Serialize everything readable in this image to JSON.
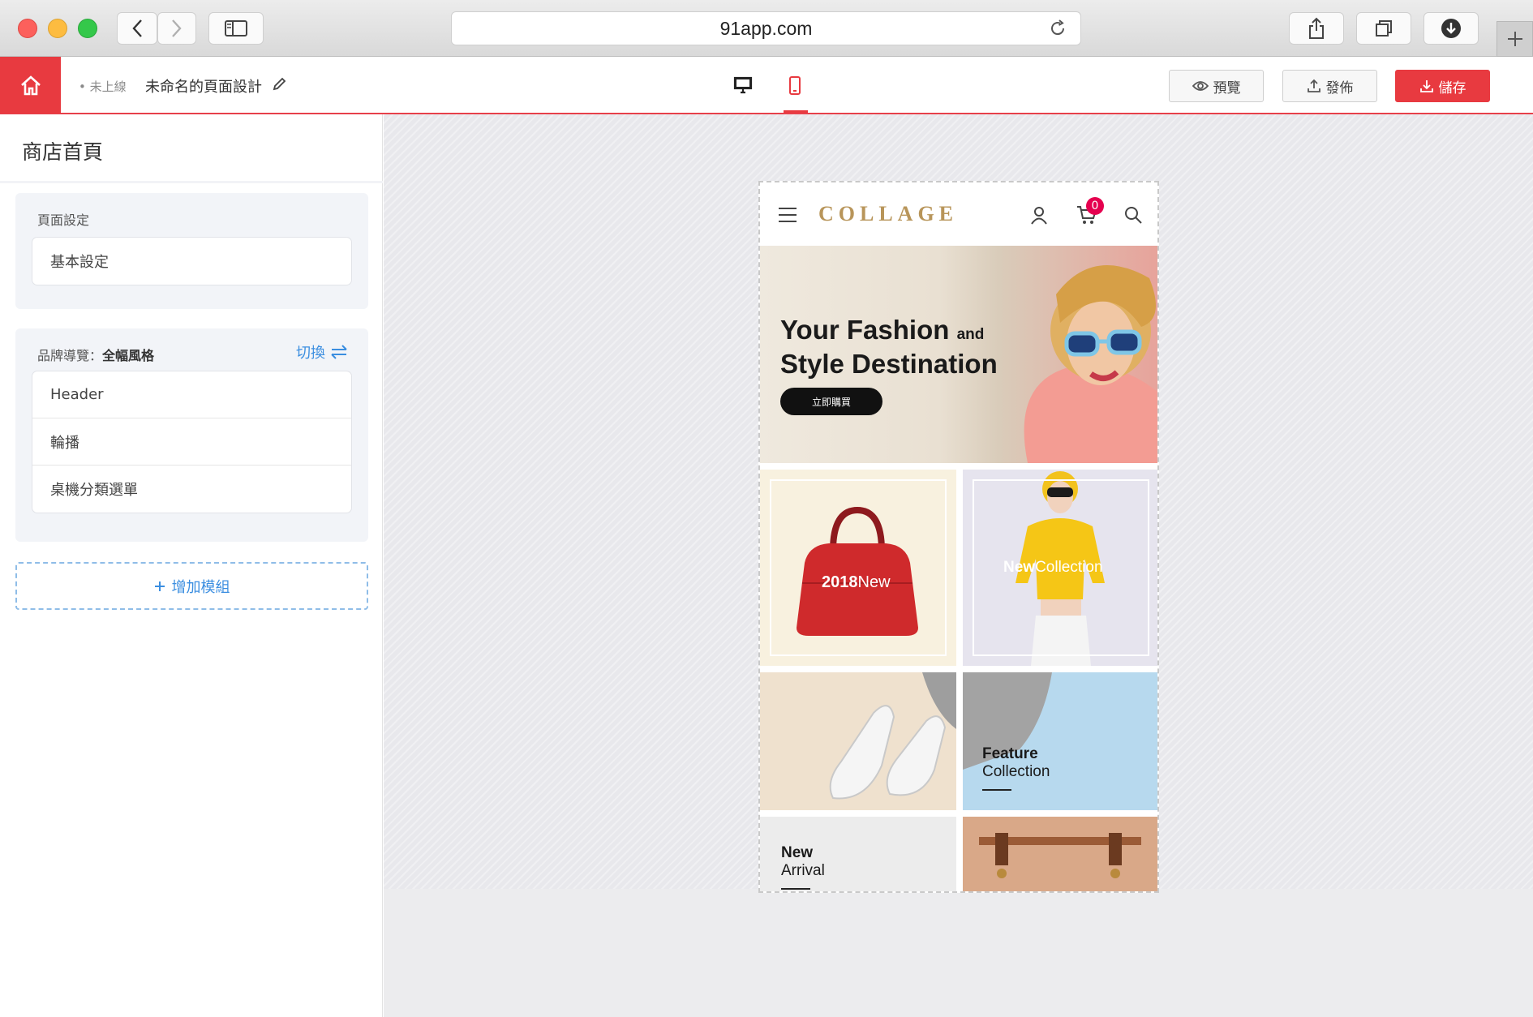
{
  "browser": {
    "url": "91app.com"
  },
  "app_header": {
    "status": "• 未上線",
    "page_name": "未命名的頁面設計",
    "preview_label": "預覽",
    "publish_label": "發佈",
    "save_label": "儲存",
    "colors": {
      "accent": "#e83a40",
      "link": "#3b8ee0"
    }
  },
  "sidebar": {
    "title": "商店首頁",
    "page_settings": {
      "label": "頁面設定",
      "items": [
        "基本設定"
      ]
    },
    "brand_nav": {
      "label": "品牌導覽：",
      "style": "全幅風格",
      "switch_label": "切換",
      "items": [
        "Header",
        "輪播",
        "桌機分類選單"
      ]
    },
    "add_module_label": "增加模組"
  },
  "preview": {
    "brand": "COLLAGE",
    "cart_count": "0",
    "hero_line1": "Your Fashion",
    "hero_and": "and",
    "hero_line2": "Style Destination",
    "hero_button": "立即購買",
    "tile1_bold": "2018",
    "tile1_light": "New",
    "tile2_bold": "New",
    "tile2_light": "Collection",
    "tile4_bold": "Feature",
    "tile4_light": "Collection",
    "tile5_bold": "New",
    "tile5_light": "Arrival"
  }
}
